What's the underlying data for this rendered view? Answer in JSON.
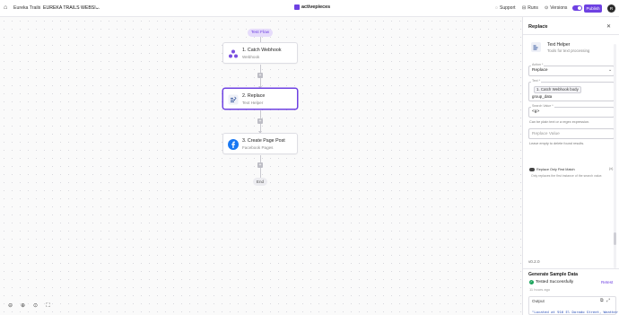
{
  "topbar": {
    "breadcrumb_folder": "Eureka Trails",
    "breadcrumb_sep": "/",
    "breadcrumb_flow": "EUREKA TRAILS WEBSI...",
    "logo_text": "activepieces",
    "support_label": "Support",
    "runs_label": "Runs",
    "versions_label": "Versions",
    "publish_label": "Publish",
    "avatar_initial": "R",
    "brand_color": "#6e41e2"
  },
  "canvas": {
    "test_flow_label": "Test Flow",
    "end_label": "End",
    "steps": [
      {
        "title": "1. Catch Webhook",
        "subtitle": "Webhook",
        "icon": "webhook-icon"
      },
      {
        "title": "2. Replace",
        "subtitle": "Text Helper",
        "icon": "text-helper-icon"
      },
      {
        "title": "3. Create Page Post",
        "subtitle": "Facebook Pages",
        "icon": "facebook-icon"
      }
    ],
    "zoom_controls": [
      "zoom-out-icon",
      "zoom-in-icon",
      "zoom-fit-icon",
      "fullscreen-icon"
    ]
  },
  "panel": {
    "title": "Replace",
    "app_name": "Text Helper",
    "app_desc": "Tools for text processing",
    "action_label": "Action *",
    "action_value": "Replace",
    "text_label": "Text *",
    "text_chip": "1. Catch Webhook body",
    "text_value": "group_data",
    "search_label": "Search Value *",
    "search_value": "<g>",
    "search_help": "Can be plain text or a regex expression.",
    "replace_placeholder": "Replace Value",
    "replace_help": "Leave empty to delete found results.",
    "replace_only_first_label": "Replace Only First Match",
    "replace_only_first_help": "Only replaces the first instance of the search value.",
    "version": "v0.2.0",
    "sample_title": "Generate Sample Data",
    "tested_label": "Tested Successfully",
    "retest_label": "Retest",
    "tested_ago": "11 hours ago",
    "output_label": "Output",
    "output_code": "\"Located at 916 El Dorado Street, Weather"
  }
}
